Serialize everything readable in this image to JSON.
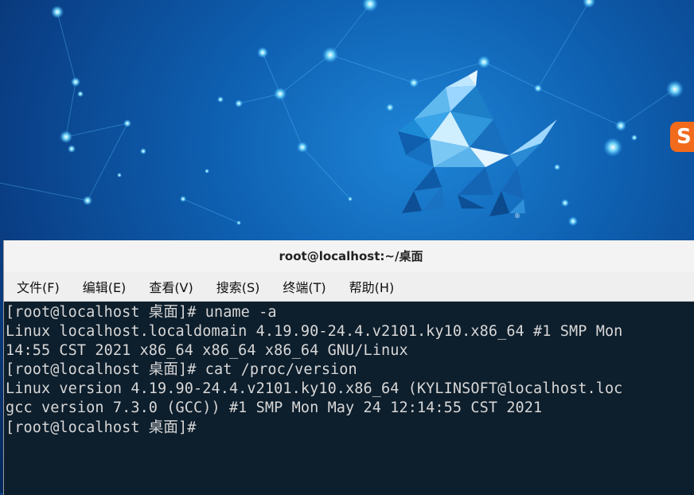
{
  "window": {
    "title": "root@localhost:~/桌面"
  },
  "menu": {
    "items": [
      {
        "label": "文件(F)",
        "name": "menu-file"
      },
      {
        "label": "编辑(E)",
        "name": "menu-edit"
      },
      {
        "label": "查看(V)",
        "name": "menu-view"
      },
      {
        "label": "搜索(S)",
        "name": "menu-search"
      },
      {
        "label": "终端(T)",
        "name": "menu-terminal"
      },
      {
        "label": "帮助(H)",
        "name": "menu-help"
      }
    ]
  },
  "terminal": {
    "lines": [
      "[root@localhost 桌面]# uname -a",
      "Linux localhost.localdomain 4.19.90-24.4.v2101.ky10.x86_64 #1 SMP Mon",
      "14:55 CST 2021 x86_64 x86_64 x86_64 GNU/Linux",
      "[root@localhost 桌面]# cat /proc/version",
      "Linux version 4.19.90-24.4.v2101.ky10.x86_64 (KYLINSOFT@localhost.loc",
      "gcc version 7.3.0 (GCC)) #1 SMP Mon May 24 12:14:55 CST 2021",
      "[root@localhost 桌面]#"
    ],
    "background": "#0d1e2c",
    "foreground": "#d7d7d7"
  },
  "desktop": {
    "logo_icon": "kylin-logo-icon",
    "tray_icon": "sogou-input-icon",
    "tray_text": "S",
    "registered_mark": "®"
  }
}
